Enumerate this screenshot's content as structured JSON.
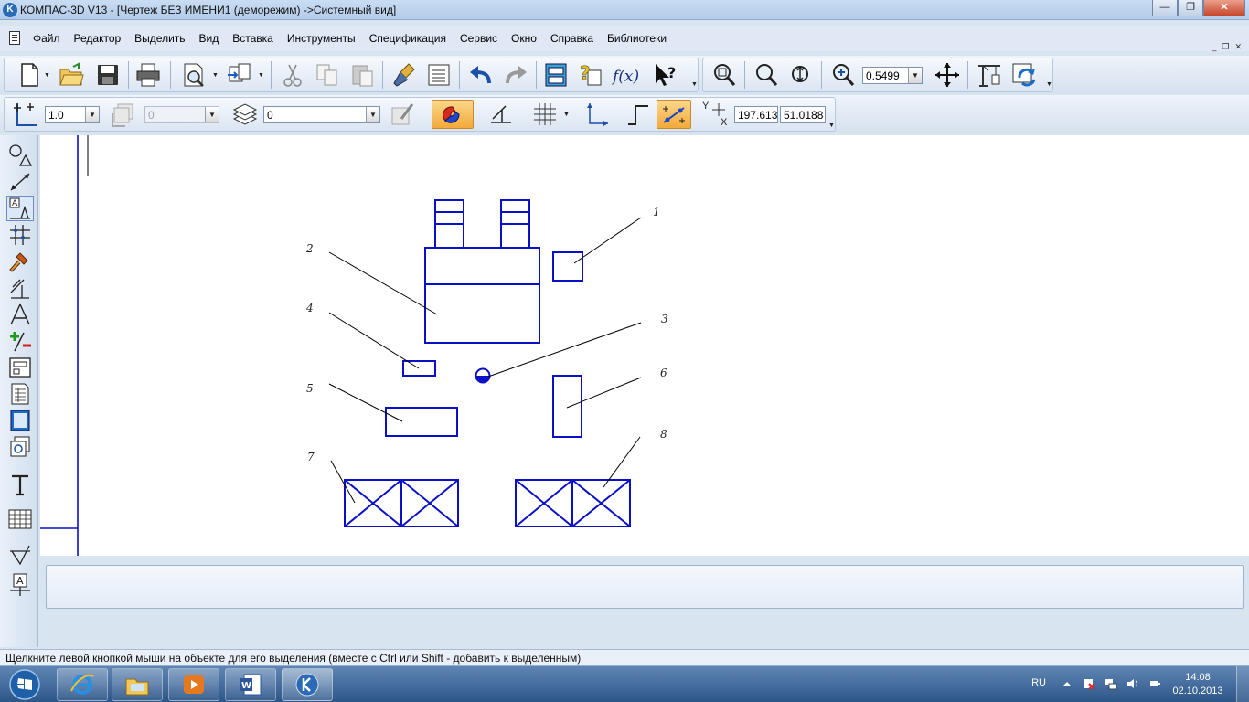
{
  "window": {
    "title": "КОМПАС-3D V13 - [Чертеж БЕЗ ИМЕНИ1 (деморежим) ->Системный вид]",
    "app_logo": "K",
    "buttons": {
      "minimize": "—",
      "maximize": "❐",
      "close": "✕"
    }
  },
  "menu": {
    "items": [
      "Файл",
      "Редактор",
      "Выделить",
      "Вид",
      "Вставка",
      "Инструменты",
      "Спецификация",
      "Сервис",
      "Окно",
      "Справка",
      "Библиотеки"
    ],
    "mdi_buttons": [
      "_",
      "❐",
      "✕"
    ]
  },
  "toolbar_main": {
    "zoom_value": "0.5499"
  },
  "toolbar_props": {
    "line_scale": "1.0",
    "angle_value": "0",
    "layer_value": "0",
    "coord_x_label": "Y",
    "coord_y_label": "X",
    "coord_x": "197.613",
    "coord_y": "51.0188"
  },
  "drawing": {
    "leader_labels": [
      "1",
      "2",
      "3",
      "4",
      "5",
      "6",
      "7",
      "8"
    ],
    "line_color": "#0a10c8"
  },
  "status": {
    "hint": "Щелкните левой кнопкой мыши на объекте для его выделения (вместе с Ctrl или Shift - добавить к выделенным)"
  },
  "taskbar": {
    "language": "RU",
    "time": "14:08",
    "date": "02.10.2013"
  },
  "colors": {
    "accent": "#2b6bb5",
    "drawing_lines": "#0a10c8",
    "active_tool": "#f3a93a"
  }
}
